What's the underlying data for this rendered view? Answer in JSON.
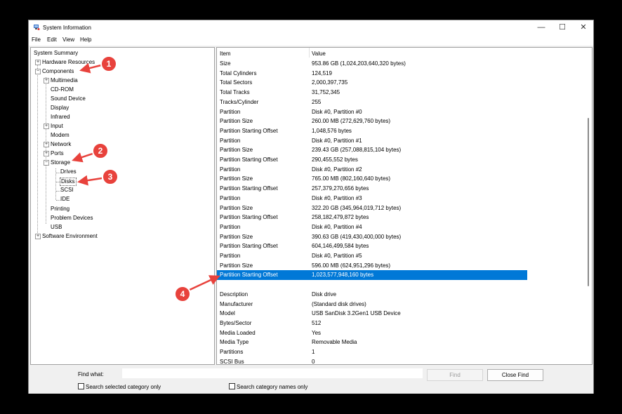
{
  "window": {
    "title": "System Information",
    "controls": {
      "minimize": "—",
      "maximize": "☐",
      "close": "✕"
    }
  },
  "menu": {
    "file": "File",
    "edit": "Edit",
    "view": "View",
    "help": "Help"
  },
  "tree": {
    "system_summary": "System Summary",
    "hardware_resources": "Hardware Resources",
    "components": "Components",
    "multimedia": "Multimedia",
    "cdrom": "CD-ROM",
    "sound_device": "Sound Device",
    "display": "Display",
    "infrared": "Infrared",
    "input": "Input",
    "modem": "Modem",
    "network": "Network",
    "ports": "Ports",
    "storage": "Storage",
    "drives": "Drives",
    "disks": "Disks",
    "scsi": "SCSI",
    "ide": "IDE",
    "printing": "Printing",
    "problem_devices": "Problem Devices",
    "usb": "USB",
    "software_environment": "Software Environment",
    "expander_plus": "+",
    "expander_minus": "−"
  },
  "table": {
    "headers": {
      "item": "Item",
      "value": "Value"
    },
    "rows": [
      {
        "item": "Size",
        "value": "953.86 GB (1,024,203,640,320 bytes)"
      },
      {
        "item": "Total Cylinders",
        "value": "124,519"
      },
      {
        "item": "Total Sectors",
        "value": "2,000,397,735"
      },
      {
        "item": "Total Tracks",
        "value": "31,752,345"
      },
      {
        "item": "Tracks/Cylinder",
        "value": "255"
      },
      {
        "item": "Partition",
        "value": "Disk #0, Partition #0"
      },
      {
        "item": "Partition Size",
        "value": "260.00 MB (272,629,760 bytes)"
      },
      {
        "item": "Partition Starting Offset",
        "value": "1,048,576 bytes"
      },
      {
        "item": "Partition",
        "value": "Disk #0, Partition #1"
      },
      {
        "item": "Partition Size",
        "value": "239.43 GB (257,088,815,104 bytes)"
      },
      {
        "item": "Partition Starting Offset",
        "value": "290,455,552 bytes"
      },
      {
        "item": "Partition",
        "value": "Disk #0, Partition #2"
      },
      {
        "item": "Partition Size",
        "value": "765.00 MB (802,160,640 bytes)"
      },
      {
        "item": "Partition Starting Offset",
        "value": "257,379,270,656 bytes"
      },
      {
        "item": "Partition",
        "value": "Disk #0, Partition #3"
      },
      {
        "item": "Partition Size",
        "value": "322.20 GB (345,964,019,712 bytes)"
      },
      {
        "item": "Partition Starting Offset",
        "value": "258,182,479,872 bytes"
      },
      {
        "item": "Partition",
        "value": "Disk #0, Partition #4"
      },
      {
        "item": "Partition Size",
        "value": "390.63 GB (419,430,400,000 bytes)"
      },
      {
        "item": "Partition Starting Offset",
        "value": "604,146,499,584 bytes"
      },
      {
        "item": "Partition",
        "value": "Disk #0, Partition #5"
      },
      {
        "item": "Partition Size",
        "value": "596.00 MB (624,951,296 bytes)"
      },
      {
        "item": "Partition Starting Offset",
        "value": "1,023,577,948,160 bytes"
      },
      {
        "item": "",
        "value": ""
      },
      {
        "item": "Description",
        "value": "Disk drive"
      },
      {
        "item": "Manufacturer",
        "value": "(Standard disk drives)"
      },
      {
        "item": "Model",
        "value": "USB  SanDisk 3.2Gen1 USB Device"
      },
      {
        "item": "Bytes/Sector",
        "value": "512"
      },
      {
        "item": "Media Loaded",
        "value": "Yes"
      },
      {
        "item": "Media Type",
        "value": "Removable Media"
      },
      {
        "item": "Partitions",
        "value": "1"
      },
      {
        "item": "SCSI Bus",
        "value": "0"
      }
    ],
    "selected_row_index": 22
  },
  "find": {
    "label": "Find what:",
    "value": "",
    "find_button": "Find",
    "close_find_button": "Close Find",
    "search_selected_label": "Search selected category only",
    "search_names_label": "Search category names only"
  },
  "annotations": {
    "badge1": "1",
    "badge2": "2",
    "badge3": "3",
    "badge4": "4",
    "color": "#e8423c"
  },
  "colors": {
    "selection": "#0078d7",
    "background": "#000000"
  }
}
